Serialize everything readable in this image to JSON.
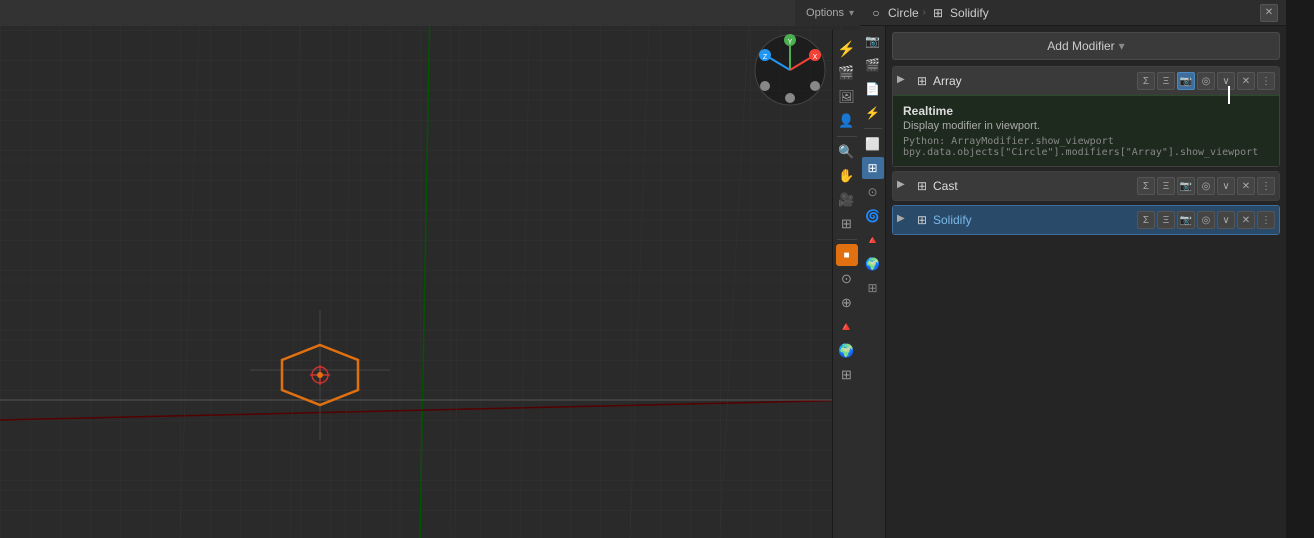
{
  "viewport": {
    "topbar": {
      "options_label": "Options",
      "dropdown_icon": "▾"
    }
  },
  "breadcrumb": {
    "object_icon": "○",
    "object_name": "Circle",
    "separator": "›",
    "modifier_icon": "⊞",
    "modifier_name": "Solidify"
  },
  "properties": {
    "add_modifier_label": "Add Modifier",
    "add_modifier_arrow": "▾",
    "modifiers": [
      {
        "name": "Array",
        "icon": "⊞",
        "expanded": false
      },
      {
        "name": "Cast",
        "icon": "⊞",
        "expanded": false
      },
      {
        "name": "Solidify",
        "icon": "⊞",
        "expanded": false,
        "active": true
      }
    ]
  },
  "tooltip": {
    "title": "Realtime",
    "description": "Display modifier in viewport.",
    "python_line1": "Python: ArrayModifier.show_viewport",
    "python_line2": "bpy.data.objects[\"Circle\"].modifiers[\"Array\"].show_viewport"
  },
  "sidebar": {
    "icons": [
      "📷",
      "🎬",
      "📄",
      "👤",
      "🔧",
      "⬟",
      "⊙",
      "🌀",
      "🔺",
      "🌍",
      "⊞"
    ]
  },
  "prop_sidebar_icons": [
    "📷",
    "🎬",
    "📄",
    "⚡",
    "🔧",
    "⬟",
    "⊙",
    "🌀",
    "🔺",
    "🌍"
  ],
  "colors": {
    "viewport_bg": "#2a2a2a",
    "panel_bg": "#252525",
    "header_bg": "#2d2d2d",
    "modifier_bg": "#3a3a3a",
    "active_blue": "#3d6e9e",
    "grid_line": "#333",
    "axis_green": "#00aa00",
    "axis_red": "#aa0000",
    "object_orange": "#e07010"
  }
}
